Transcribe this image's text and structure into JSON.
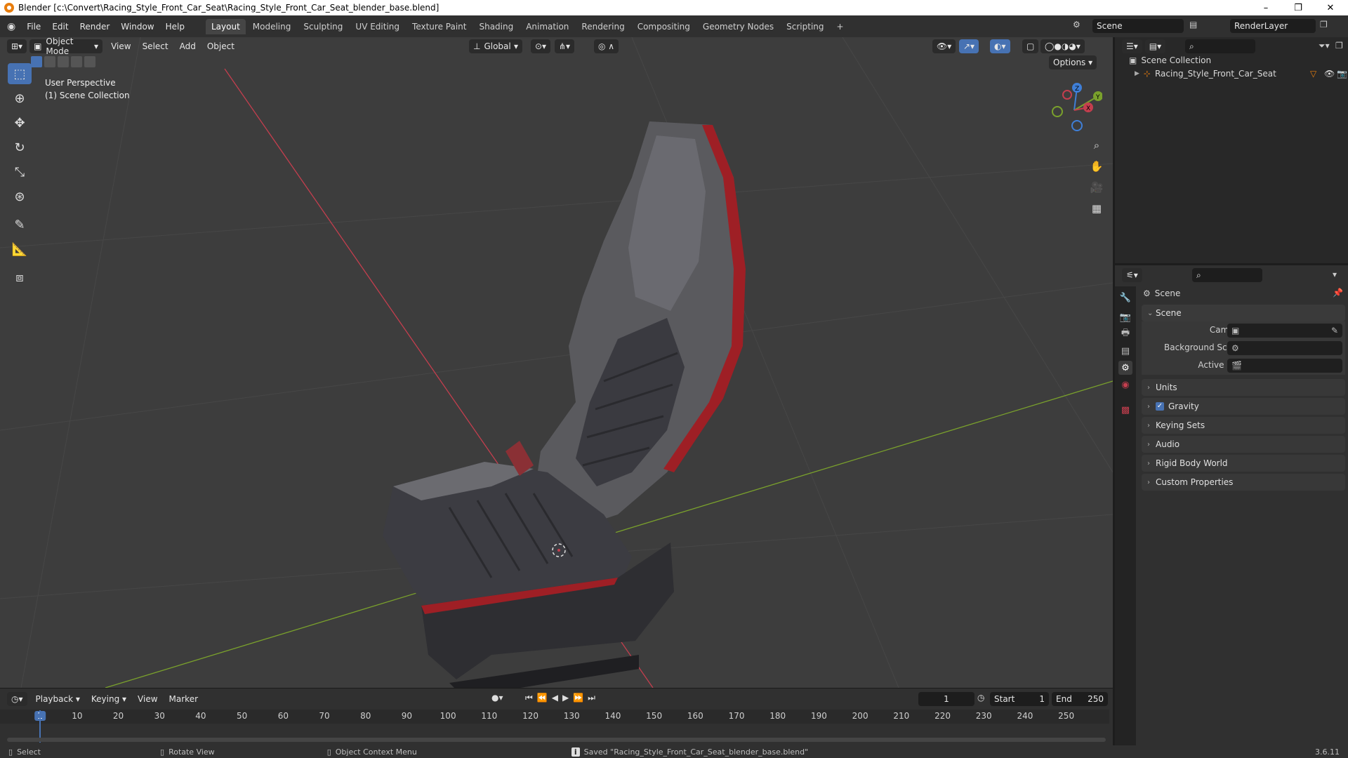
{
  "window": {
    "title": "Blender [c:\\Convert\\Racing_Style_Front_Car_Seat\\Racing_Style_Front_Car_Seat_blender_base.blend]",
    "controls": [
      "–",
      "❐",
      "✕"
    ]
  },
  "menu": {
    "items": [
      "File",
      "Edit",
      "Render",
      "Window",
      "Help"
    ],
    "workspaces": [
      "Layout",
      "Modeling",
      "Sculpting",
      "UV Editing",
      "Texture Paint",
      "Shading",
      "Animation",
      "Rendering",
      "Compositing",
      "Geometry Nodes",
      "Scripting",
      "+"
    ],
    "active_workspace": "Layout",
    "scene": "Scene",
    "view_layer": "RenderLayer"
  },
  "viewport": {
    "mode": "Object Mode",
    "header_menus": [
      "View",
      "Select",
      "Add",
      "Object"
    ],
    "orientation": "Global",
    "options_label": "Options",
    "overlay_line1": "User Perspective",
    "overlay_line2": "(1) Scene Collection",
    "tools": [
      "select-box",
      "cursor",
      "move",
      "rotate",
      "scale",
      "transform",
      "annotate",
      "measure",
      "add-cube"
    ],
    "active_tool": "select-box",
    "gizmo_axes": {
      "z": "Z",
      "y": "Y",
      "x": "X"
    }
  },
  "timeline": {
    "menus": [
      "Playback",
      "Keying",
      "View",
      "Marker"
    ],
    "current_frame": "1",
    "start_label": "Start",
    "start": "1",
    "end_label": "End",
    "end": "250",
    "ticks": [
      "1",
      "10",
      "20",
      "30",
      "40",
      "50",
      "60",
      "70",
      "80",
      "90",
      "100",
      "110",
      "120",
      "130",
      "140",
      "150",
      "160",
      "170",
      "180",
      "190",
      "200",
      "210",
      "220",
      "230",
      "240",
      "250"
    ]
  },
  "outliner": {
    "root": "Scene Collection",
    "items": [
      "Racing_Style_Front_Car_Seat"
    ]
  },
  "properties": {
    "context": "Scene",
    "panel_title": "Scene",
    "fields": {
      "camera": "Camera",
      "background_scene": "Background Scene",
      "active_clip": "Active Clip"
    },
    "subpanels": [
      "Units",
      "Gravity",
      "Keying Sets",
      "Audio",
      "Rigid Body World",
      "Custom Properties"
    ],
    "gravity_checked": true
  },
  "status": {
    "select": "Select",
    "rotate": "Rotate View",
    "context_menu": "Object Context Menu",
    "message": "Saved \"Racing_Style_Front_Car_Seat_blender_base.blend\"",
    "version": "3.6.11"
  },
  "colors": {
    "accent": "#4772b3",
    "x_axis": "#c43e4e",
    "y_axis": "#7aa12c",
    "z_axis": "#3f7fd8",
    "seat_red": "#9e1f25"
  }
}
